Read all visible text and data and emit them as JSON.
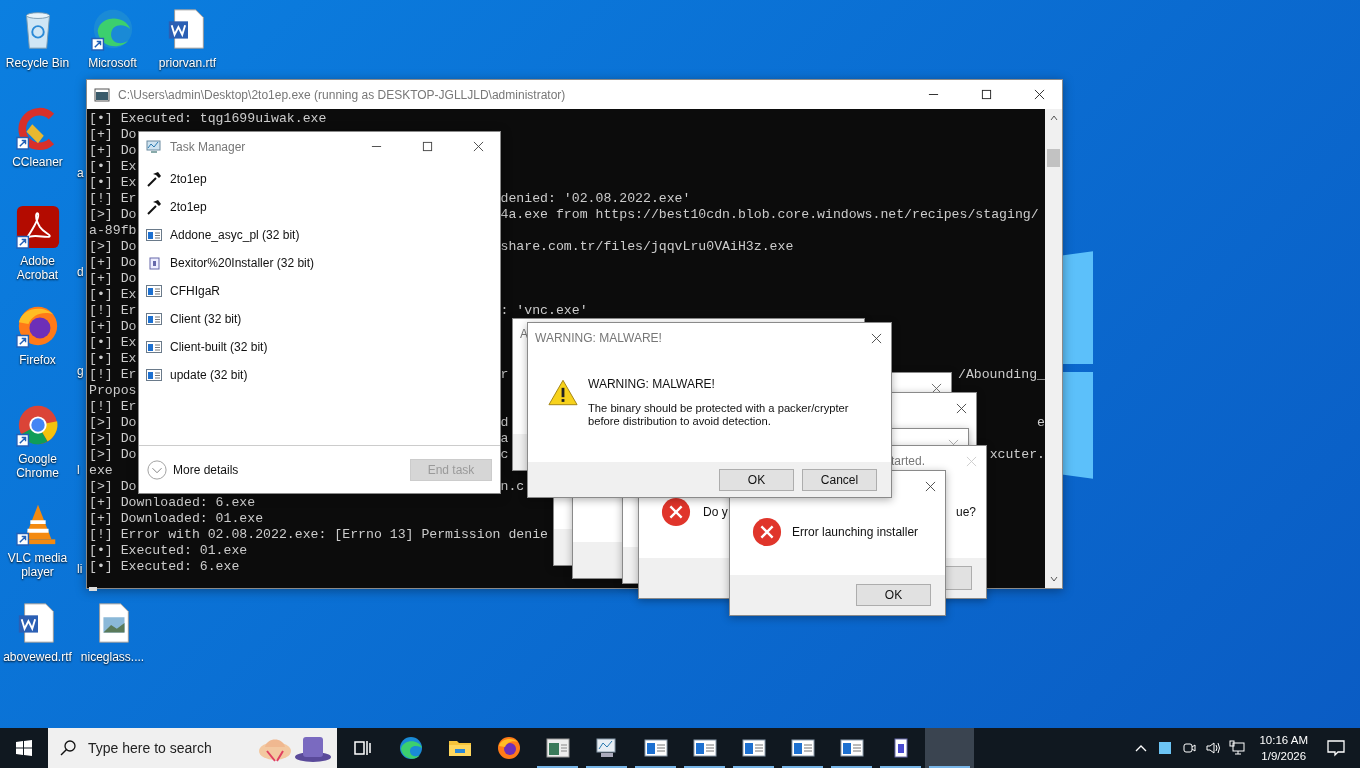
{
  "desktop": {
    "icons": [
      {
        "label": "Recycle Bin",
        "kind": "recycle",
        "shortcut": false
      },
      {
        "label": "CCleaner",
        "kind": "ccleaner",
        "shortcut": true
      },
      {
        "label": "Adobe Acrobat",
        "kind": "acrobat",
        "shortcut": true
      },
      {
        "label": "Firefox",
        "kind": "firefox",
        "shortcut": true
      },
      {
        "label": "Google Chrome",
        "kind": "chrome",
        "shortcut": true
      },
      {
        "label": "VLC media player",
        "kind": "vlc",
        "shortcut": true
      },
      {
        "label": "abovewed.rtf",
        "kind": "word",
        "shortcut": false
      },
      {
        "label": "Microsoft",
        "kind": "edge",
        "shortcut": true
      },
      {
        "label": "a",
        "kind": "hidden"
      },
      {
        "label": "d",
        "kind": "hidden"
      },
      {
        "label": "g",
        "kind": "hidden"
      },
      {
        "label": "l",
        "kind": "hidden"
      },
      {
        "label": "li",
        "kind": "hidden"
      },
      {
        "label": "niceglass....",
        "kind": "image",
        "shortcut": false
      },
      {
        "label": "priorvan.rtf",
        "kind": "word",
        "shortcut": false
      }
    ]
  },
  "console": {
    "title": "C:\\Users\\admin\\Desktop\\2to1ep.exe (running as DESKTOP-JGLLJLD\\administrator)",
    "lines": [
      {
        "left": "[•] Executed: tqg1699uiwak.exe"
      },
      {
        "left": "[+] Do"
      },
      {
        "left": "[+] Do"
      },
      {
        "left": "[•] Ex"
      },
      {
        "left": "[•] Ex"
      },
      {
        "left": "[!] Er",
        "right": "denied: '02.08.2022.exe'"
      },
      {
        "left": "[>] Do",
        "right": "4a.exe from https://best10cdn.blob.core.windows.net/recipes/staging/"
      },
      {
        "left": "a-89fb"
      },
      {
        "left": "[>] Do",
        "right": "share.com.tr/files/jqqvLru0VAiH3z.exe"
      },
      {
        "left": "[+] Do"
      },
      {
        "left": "[+] Do"
      },
      {
        "left": "[•] Ex"
      },
      {
        "left": "[!] Er",
        "right": ": 'vnc.exe'"
      },
      {
        "left": "[+] Do"
      },
      {
        "left": "[•] Ex"
      },
      {
        "left": "[•] Ex"
      },
      {
        "left": "[!] Er",
        "right": "r",
        "far": "/Abounding_"
      },
      {
        "left": "Propos"
      },
      {
        "left": "[!] Er"
      },
      {
        "left": "[>] Do",
        "right": "d",
        "far": "e"
      },
      {
        "left": "[>] Do",
        "right": "a"
      },
      {
        "left": "[>] Do",
        "right": "c",
        "far": "xcuter."
      },
      {
        "left": "exe"
      },
      {
        "left": "[>] Do",
        "right": "n.c"
      },
      {
        "left": "[+] Downloaded: 6.exe"
      },
      {
        "left": "[+] Downloaded: 01.exe"
      },
      {
        "left": "[!] Error with 02.08.2022.exe: [Errno 13] Permission denie"
      },
      {
        "left": "[•] Executed: 01.exe"
      },
      {
        "left": "[•] Executed: 6.exe"
      }
    ]
  },
  "task_manager": {
    "title": "Task Manager",
    "processes": [
      {
        "name": "2to1ep",
        "kind": "hammer"
      },
      {
        "name": "2to1ep",
        "kind": "hammer"
      },
      {
        "name": "Addone_asyc_pl (32 bit)",
        "kind": "app"
      },
      {
        "name": "Bexitor%20Installer (32 bit)",
        "kind": "installer"
      },
      {
        "name": "CFHIgaR",
        "kind": "app"
      },
      {
        "name": "Client (32 bit)",
        "kind": "app"
      },
      {
        "name": "Client-built (32 bit)",
        "kind": "app"
      },
      {
        "name": "update (32 bit)",
        "kind": "app"
      }
    ],
    "more_details": "More details",
    "end_task": {
      "label": "End task",
      "disabled": true
    }
  },
  "back_dialogs": {
    "first_title": "A",
    "prompt_title": "tarted.",
    "prompt_text_start": "Do y",
    "prompt_text_end": "ue?"
  },
  "warning_dialog": {
    "title": "WARNING: MALWARE!",
    "heading": "WARNING: MALWARE!",
    "message": "The binary should be protected with a packer/crypter before distribution to avoid detection.",
    "buttons": [
      "OK",
      "Cancel"
    ]
  },
  "error_dialog": {
    "message": "Error launching installer",
    "button": "OK"
  },
  "taskbar": {
    "search_placeholder": "Type here to search",
    "apps": [
      {
        "kind": "taskview",
        "running": false,
        "active": false
      },
      {
        "kind": "edge",
        "running": false,
        "active": false
      },
      {
        "kind": "folder",
        "running": false,
        "active": false
      },
      {
        "kind": "firefox",
        "running": false,
        "active": false
      },
      {
        "kind": "console",
        "running": true,
        "active": false
      },
      {
        "kind": "monitor",
        "running": true,
        "active": false
      },
      {
        "kind": "window",
        "running": true,
        "active": false
      },
      {
        "kind": "window",
        "running": true,
        "active": false
      },
      {
        "kind": "window",
        "running": true,
        "active": false
      },
      {
        "kind": "window",
        "running": true,
        "active": false
      },
      {
        "kind": "window",
        "running": true,
        "active": false
      },
      {
        "kind": "installer",
        "running": true,
        "active": false
      },
      {
        "kind": "blank",
        "running": true,
        "active": true
      }
    ],
    "time": "10:16 AM",
    "date": "1/9/2026"
  }
}
